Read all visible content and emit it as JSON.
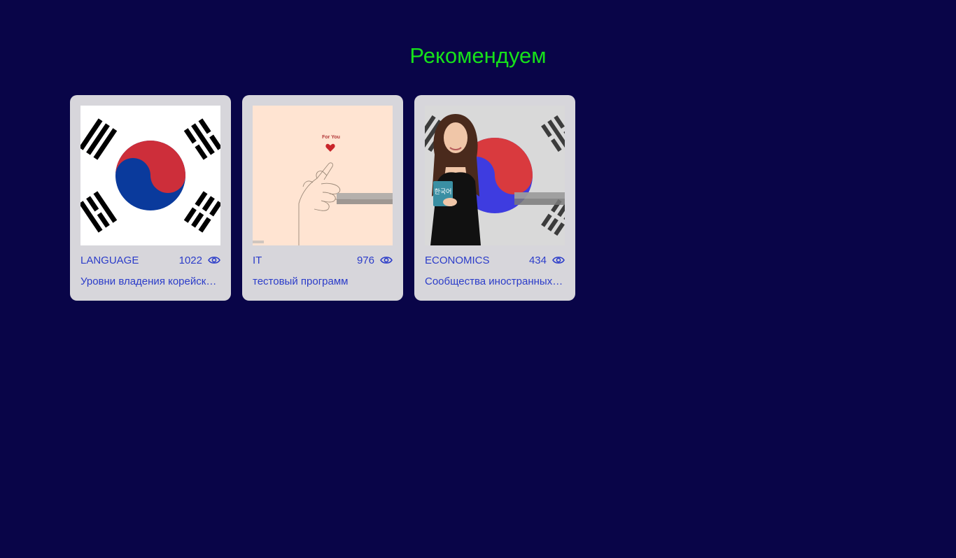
{
  "section": {
    "title": "Рекомендуем"
  },
  "cards": [
    {
      "category": "LANGUAGE",
      "views": "1022",
      "title": "Уровни владения корейским языком",
      "image_icon": "korean-flag-image"
    },
    {
      "category": "IT",
      "views": "976",
      "title": "тестовый программ",
      "image_icon": "finger-heart-image",
      "image_caption": "For You"
    },
    {
      "category": "ECONOMICS",
      "views": "434",
      "title": "Сообщества иностранных студентов",
      "image_icon": "woman-with-korean-book-image"
    }
  ],
  "colors": {
    "background": "#090548",
    "title": "#16e11a",
    "card": "#d7d6db",
    "card_text": "#2b3cc9"
  }
}
